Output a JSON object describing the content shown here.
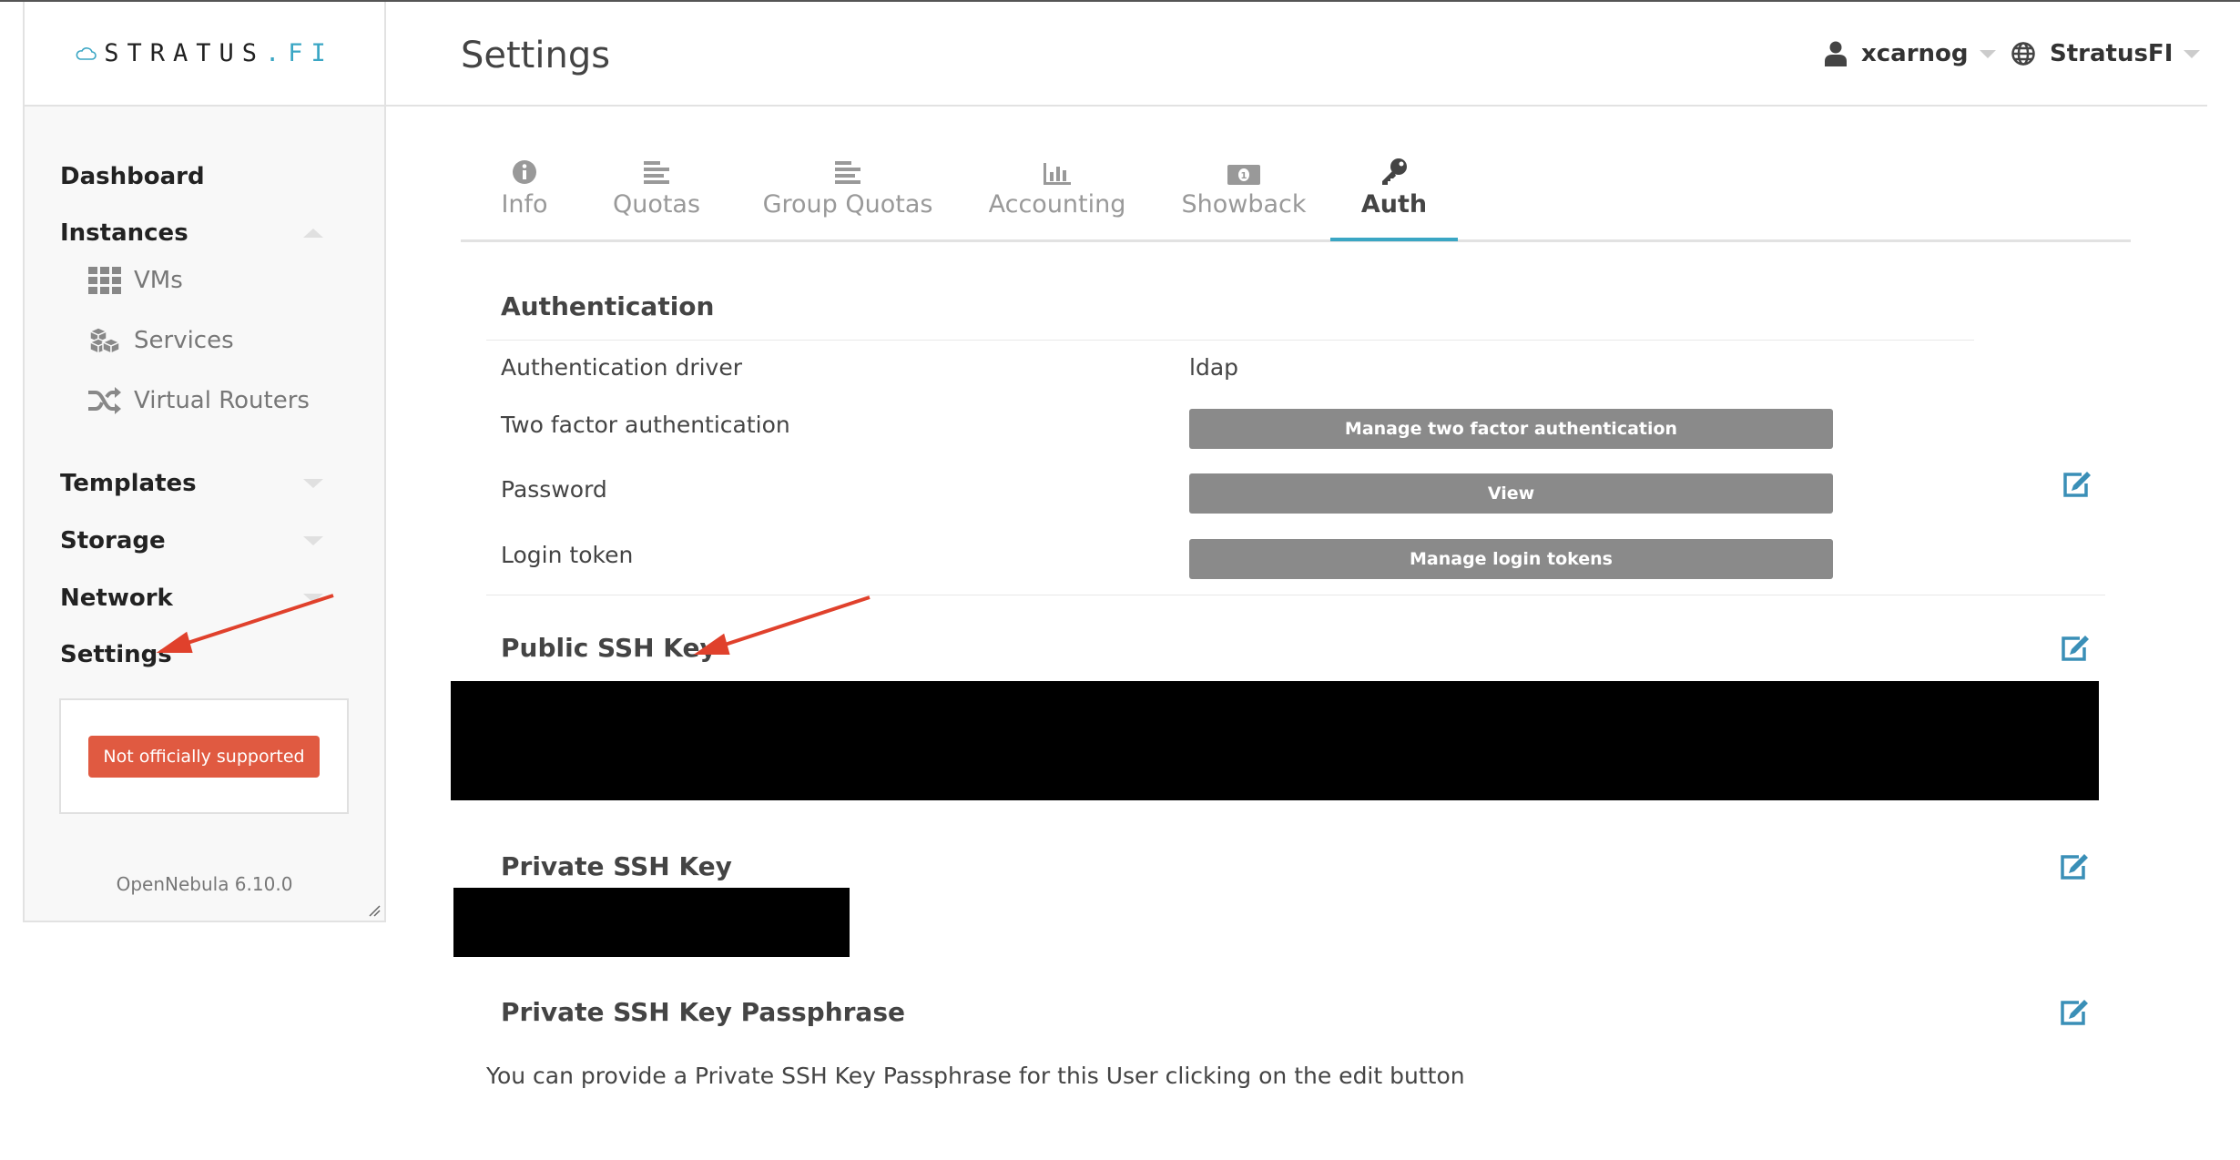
{
  "brand": {
    "name_main": "STRATUS",
    "name_dot": ".",
    "name_accent": "FI",
    "accent_color": "#3aa6c4"
  },
  "sidebar": {
    "items": [
      {
        "label": "Dashboard"
      },
      {
        "label": "Instances",
        "expanded": true,
        "children": [
          {
            "label": "VMs",
            "icon": "grid-icon"
          },
          {
            "label": "Services",
            "icon": "cubes-icon"
          },
          {
            "label": "Virtual Routers",
            "icon": "random-icon"
          }
        ]
      },
      {
        "label": "Templates"
      },
      {
        "label": "Storage"
      },
      {
        "label": "Network"
      },
      {
        "label": "Settings"
      }
    ],
    "support_badge": "Not officially supported",
    "version": "OpenNebula 6.10.0"
  },
  "header": {
    "title": "Settings",
    "user": "xcarnog",
    "zone": "StratusFI"
  },
  "tabs": [
    {
      "label": "Info",
      "icon": "info-icon"
    },
    {
      "label": "Quotas",
      "icon": "align-left-icon"
    },
    {
      "label": "Group Quotas",
      "icon": "align-left-icon"
    },
    {
      "label": "Accounting",
      "icon": "bar-chart-icon"
    },
    {
      "label": "Showback",
      "icon": "money-icon"
    },
    {
      "label": "Auth",
      "icon": "key-icon",
      "active": true
    }
  ],
  "auth": {
    "title": "Authentication",
    "driver_label": "Authentication driver",
    "driver_value": "ldap",
    "two_factor_label": "Two factor authentication",
    "two_factor_button": "Manage two factor authentication",
    "password_label": "Password",
    "password_button": "View",
    "login_token_label": "Login token",
    "login_token_button": "Manage login tokens"
  },
  "public_ssh": {
    "title": "Public SSH Key"
  },
  "private_ssh": {
    "title": "Private SSH Key"
  },
  "passphrase": {
    "title": "Private SSH Key Passphrase",
    "help": "You can provide a Private SSH Key Passphrase for this User clicking on the edit button"
  },
  "colors": {
    "danger": "#e05a41",
    "button_gray": "#8a8a8a",
    "edit_icon": "#3a8fb7",
    "annotation_arrow": "#e0412c"
  }
}
